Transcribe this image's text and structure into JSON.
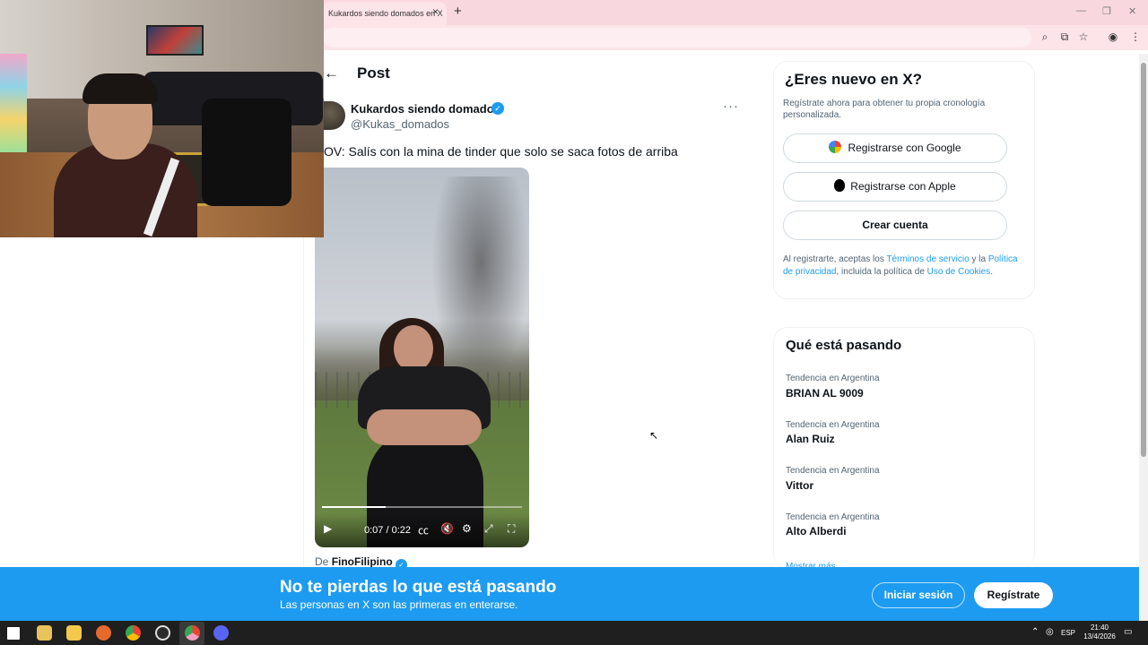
{
  "browser": {
    "tab_title": "Kukardos siendo domados en X",
    "tab_close": "×",
    "new_tab": "+",
    "window_minimize": "—",
    "window_restore": "❐",
    "window_close": "✕",
    "toolbar_icons": [
      "zoom-icon",
      "install-icon",
      "bookmark-star-icon",
      "profile-icon",
      "menu-kebab-icon"
    ]
  },
  "post": {
    "header": "Post",
    "back": "←",
    "author_name": "Kukardos siendo domados",
    "author_handle": "@Kukas_domados",
    "more": "···",
    "text": "OV: Salís con la mina de tinder que solo se saca fotos de arriba",
    "video": {
      "time": "0:07 / 0:22",
      "progress": 0.32,
      "controls": [
        "play-icon",
        "captions-icon",
        "mute-icon",
        "settings-icon",
        "fullscreen-exit-icon",
        "fullscreen-icon"
      ]
    },
    "source_prefix": "De",
    "source_name": "FinoFilipino"
  },
  "signup": {
    "title": "¿Eres nuevo en X?",
    "subtitle": "Regístrate ahora para obtener tu propia cronología personalizada.",
    "google": "Registrarse con Google",
    "apple": "Registrarse con Apple",
    "create": "Crear cuenta",
    "terms_1": "Al registrarte, aceptas los ",
    "terms_link_1": "Términos de servicio",
    "terms_2": " y la ",
    "terms_link_2": "Política de privacidad",
    "terms_3": ", incluida la política de ",
    "terms_link_3": "Uso de Cookies",
    "terms_4": "."
  },
  "trends": {
    "title": "Qué está pasando",
    "items": [
      {
        "meta": "Tendencia en Argentina",
        "name": "BRIAN AL 9009"
      },
      {
        "meta": "Tendencia en Argentina",
        "name": "Alan Ruiz"
      },
      {
        "meta": "Tendencia en Argentina",
        "name": "Vittor"
      },
      {
        "meta": "Tendencia en Argentina",
        "name": "Alto Alberdi"
      }
    ],
    "show_more": "Mostrar más"
  },
  "banner": {
    "title": "No te pierdas lo que está pasando",
    "subtitle": "Las personas en X son las primeras en enterarse.",
    "login": "Iniciar sesión",
    "register": "Regístrate"
  },
  "taskbar": {
    "lang": "ESP",
    "time": "21:40",
    "date": "13/4/2026",
    "apps": [
      "windows-start-icon",
      "media-player-icon",
      "file-explorer-icon",
      "firefox-icon",
      "chrome-icon",
      "obs-icon",
      "chrome-pink-icon",
      "discord-icon"
    ]
  },
  "colors": {
    "accent": "#1d9bf0",
    "tab_strip": "#f9d7de",
    "banner": "#1d9bf0"
  }
}
